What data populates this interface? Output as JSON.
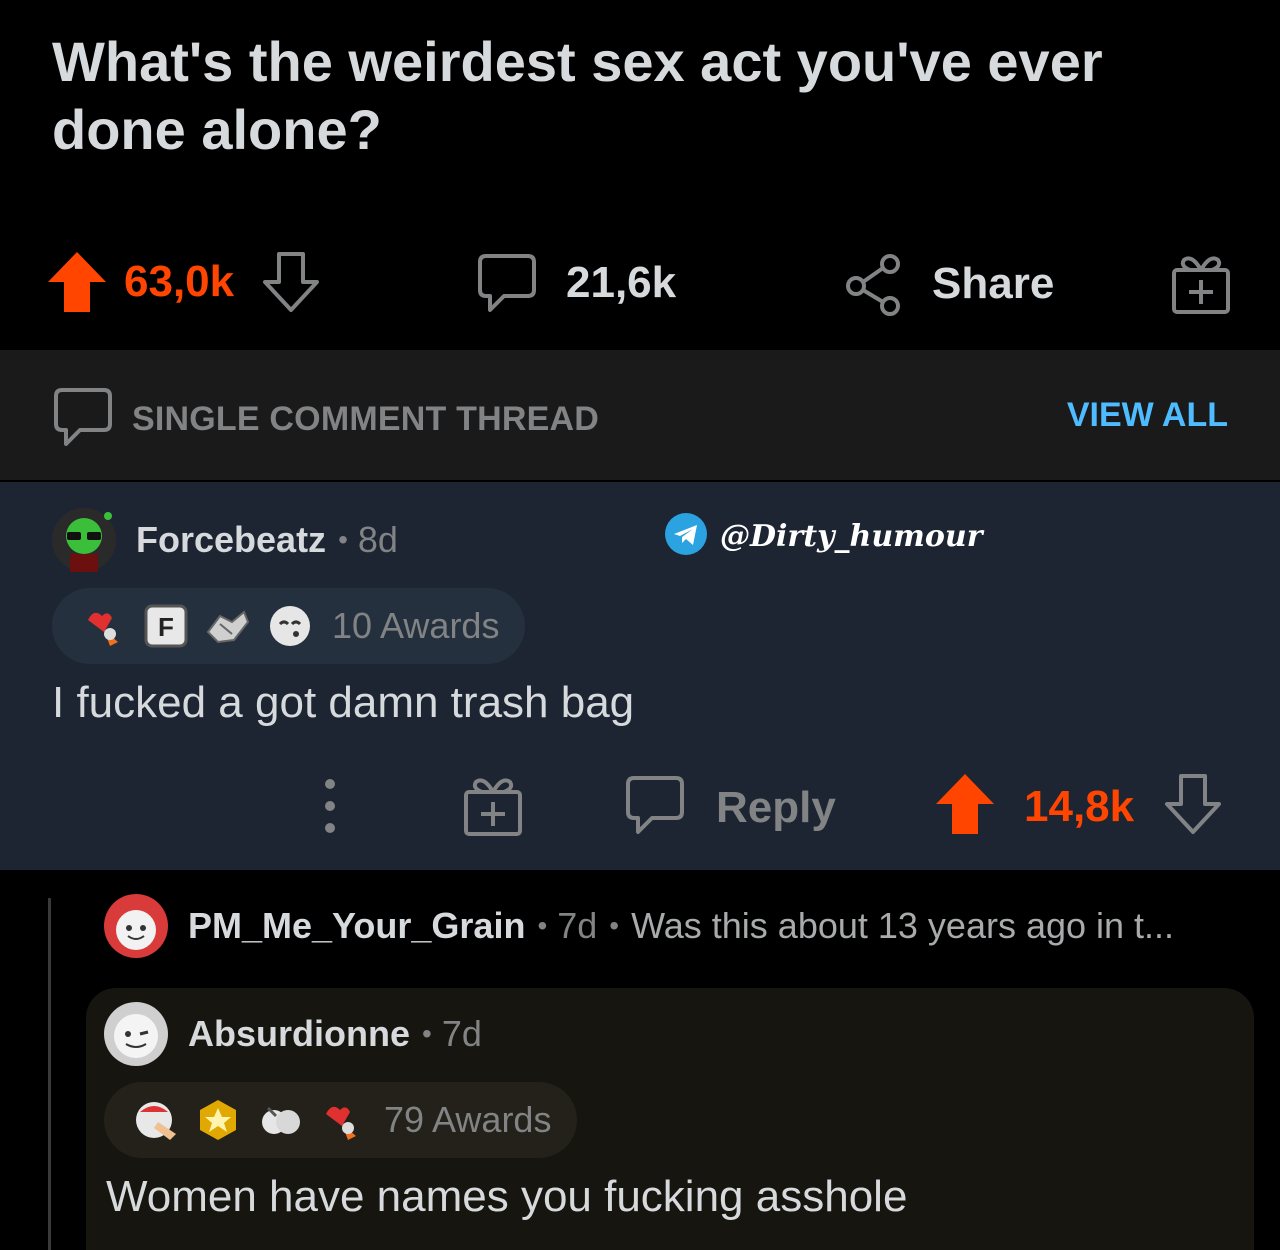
{
  "post": {
    "title": "What's the weirdest sex act you've ever done alone?",
    "votes": "63,0k",
    "comments": "21,6k",
    "share_label": "Share"
  },
  "thread": {
    "label": "SINGLE COMMENT THREAD",
    "view_all": "VIEW ALL"
  },
  "watermark": {
    "handle": "@Dirty_humour"
  },
  "comments": [
    {
      "username": "Forcebeatz",
      "age": "8d",
      "awards_label": "10 Awards",
      "awards": [
        "rocket-like-icon",
        "press-f-icon",
        "handshake-icon",
        "blow-kiss-icon"
      ],
      "body": "I fucked a got damn trash bag",
      "reply_label": "Reply",
      "votes": "14,8k"
    },
    {
      "username": "PM_Me_Your_Grain",
      "age": "7d",
      "preview": "Was this about 13 years ago in t..."
    },
    {
      "username": "Absurdionne",
      "age": "7d",
      "awards_label": "79 Awards",
      "awards": [
        "facepalm-icon",
        "gold-star-icon",
        "wholesome-icon",
        "rocket-like-icon"
      ],
      "body": "Women have names you fucking asshole"
    }
  ],
  "colors": {
    "upvote": "#ff4500",
    "link": "#4fbcff",
    "background": "#000000",
    "highlight_comment": "#1d2532"
  }
}
